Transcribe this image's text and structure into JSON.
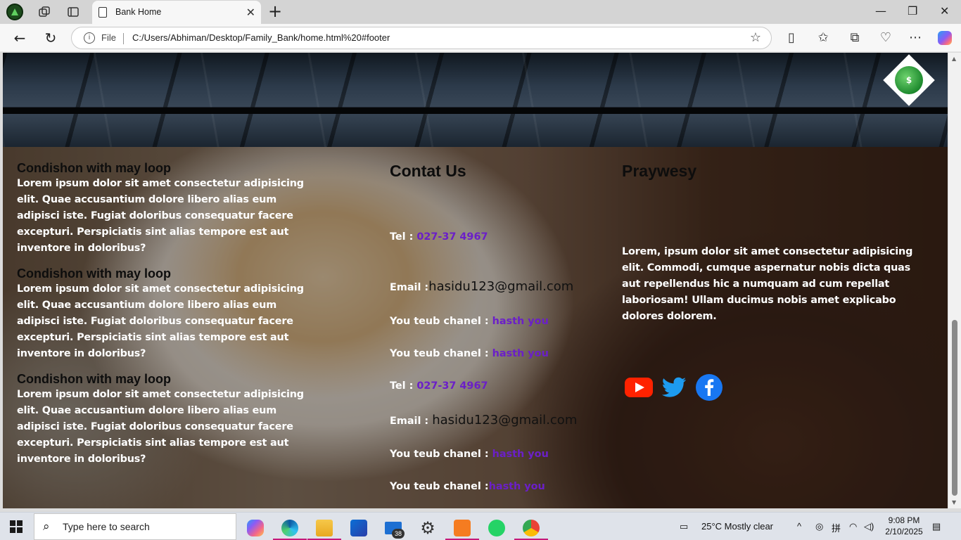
{
  "browser": {
    "tab_title": "Bank Home",
    "address": {
      "scheme_label": "File",
      "url": "C:/Users/Abhiman/Desktop/Family_Bank/home.html%20#footer"
    }
  },
  "page": {
    "left_blocks": [
      {
        "heading": "Condishon with may loop",
        "text": "Lorem ipsum dolor sit amet consectetur adipisicing elit. Quae accusantium dolore libero alias eum adipisci iste. Fugiat doloribus consequatur facere excepturi. Perspiciatis sint alias tempore est aut inventore in doloribus?"
      },
      {
        "heading": "Condishon with may loop",
        "text": "Lorem ipsum dolor sit amet consectetur adipisicing elit. Quae accusantium dolore libero alias eum adipisci iste. Fugiat doloribus consequatur facere excepturi. Perspiciatis sint alias tempore est aut inventore in doloribus?"
      },
      {
        "heading": "Condishon with may loop",
        "text": "Lorem ipsum dolor sit amet consectetur adipisicing elit. Quae accusantium dolore libero alias eum adipisci iste. Fugiat doloribus consequatur facere excepturi. Perspiciatis sint alias tempore est aut inventore in doloribus?"
      }
    ],
    "contact": {
      "heading": "Contat Us",
      "tel_label_1": "Tel : ",
      "tel_1": "027-37 4967",
      "email_label_1": "Email :",
      "email_1": "hasidu123@gmail.com",
      "yt_label_1": "You teub chanel : ",
      "yt_1": "hasth you",
      "yt_label_2": "You teub chanel : ",
      "yt_2": "hasth you",
      "tel_label_2": "Tel : ",
      "tel_2": "027-37 4967",
      "email_label_2": "Email : ",
      "email_2": "hasidu123@gmail.com",
      "yt_label_3": "You teub chanel : ",
      "yt_3": "hasth you",
      "yt_label_4": "You teub chanel :",
      "yt_4": "hasth you"
    },
    "privacy": {
      "heading": "Praywesy",
      "text": "Lorem, ipsum dolor sit amet consectetur adipisicing elit. Commodi, cumque aspernatur nobis dicta quas aut repellendus hic a numquam ad cum repellat laboriosam! Ullam ducimus nobis amet explicabo dolores dolorem."
    },
    "social_icons": [
      "youtube-icon",
      "twitter-icon",
      "facebook-icon"
    ],
    "link_color": "#6b1fc8"
  },
  "taskbar": {
    "search_placeholder": "Type here to search",
    "mail_badge": "38",
    "weather": "25°C  Mostly clear",
    "time": "9:08 PM",
    "date": "2/10/2025"
  }
}
